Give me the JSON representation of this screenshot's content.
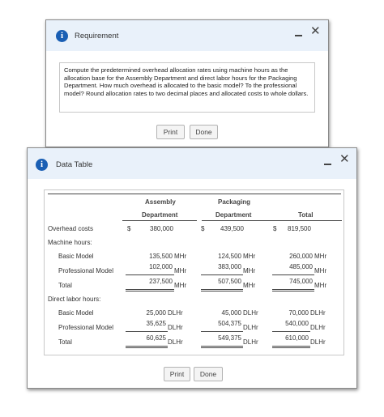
{
  "requirement": {
    "title": "Requirement",
    "text": "Compute the predetermined overhead allocation rates using machine hours as the allocation base for the Assembly Department and direct labor hours for the Packaging Department. How much overhead is allocated to the basic model? To the professional model? Round allocation rates to two decimal places and allocated costs to whole dollars.",
    "print_label": "Print",
    "done_label": "Done"
  },
  "data_table": {
    "title": "Data Table",
    "print_label": "Print",
    "done_label": "Done",
    "headers": {
      "assembly_line1": "Assembly",
      "assembly_line2": "Department",
      "packaging_line1": "Packaging",
      "packaging_line2": "Department",
      "total": "Total"
    },
    "overhead": {
      "label": "Overhead costs",
      "cur": "$",
      "assembly": "380,000",
      "packaging": "439,500",
      "total": "819,500"
    },
    "machine_hours_label": "Machine hours:",
    "mh_rows": [
      {
        "label": "Basic Model",
        "assembly": "135,500",
        "packaging": "124,500",
        "total": "260,000",
        "unit": "MHr"
      },
      {
        "label": "Professional Model",
        "assembly": "102,000",
        "packaging": "383,000",
        "total": "485,000",
        "unit": "MHr"
      },
      {
        "label": "Total",
        "assembly": "237,500",
        "packaging": "507,500",
        "total": "745,000",
        "unit": "MHr"
      }
    ],
    "direct_labor_label": "Direct labor hours:",
    "dl_rows": [
      {
        "label": "Basic Model",
        "assembly": "25,000",
        "packaging": "45,000",
        "total": "70,000",
        "unit": "DLHr"
      },
      {
        "label": "Professional Model",
        "assembly": "35,625",
        "packaging": "504,375",
        "total": "540,000",
        "unit": "DLHr"
      },
      {
        "label": "Total",
        "assembly": "60,625",
        "packaging": "549,375",
        "total": "610,000",
        "unit": "DLHr"
      }
    ]
  }
}
